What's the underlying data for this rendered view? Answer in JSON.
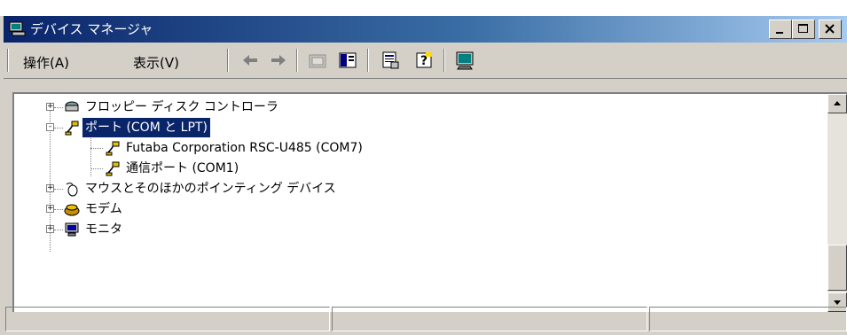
{
  "window": {
    "title": "デバイス マネージャ",
    "controls": [
      "minimize-icon",
      "maximize-icon",
      "close-icon"
    ]
  },
  "menu": {
    "action": "操作(A)",
    "view": "表示(V)"
  },
  "toolbar": {
    "buttons": [
      "back-arrow-icon",
      "forward-arrow-icon",
      "up-folder-icon",
      "show-hide-tree-icon",
      "properties-icon",
      "help-icon",
      "scan-hardware-icon"
    ]
  },
  "tree": {
    "items": [
      {
        "label": "フロッピー ディスク コントローラ",
        "expander": "+",
        "icon": "floppy-controller-icon"
      },
      {
        "label": "ポート (COM と LPT)",
        "expander": "-",
        "icon": "port-connector-icon",
        "selected": true
      },
      {
        "label": "Futaba Corporation RSC-U485 (COM7)",
        "icon": "port-connector-icon"
      },
      {
        "label": "通信ポート (COM1)",
        "icon": "port-connector-icon"
      },
      {
        "label": "マウスとそのほかのポインティング デバイス",
        "expander": "+",
        "icon": "mouse-icon"
      },
      {
        "label": "モデム",
        "expander": "+",
        "icon": "modem-icon"
      },
      {
        "label": "モニタ",
        "expander": "+",
        "icon": "monitor-icon"
      }
    ]
  },
  "colors": {
    "title_active": "#0a246a",
    "face": "#d4d0c8",
    "selection": "#0a246a"
  }
}
